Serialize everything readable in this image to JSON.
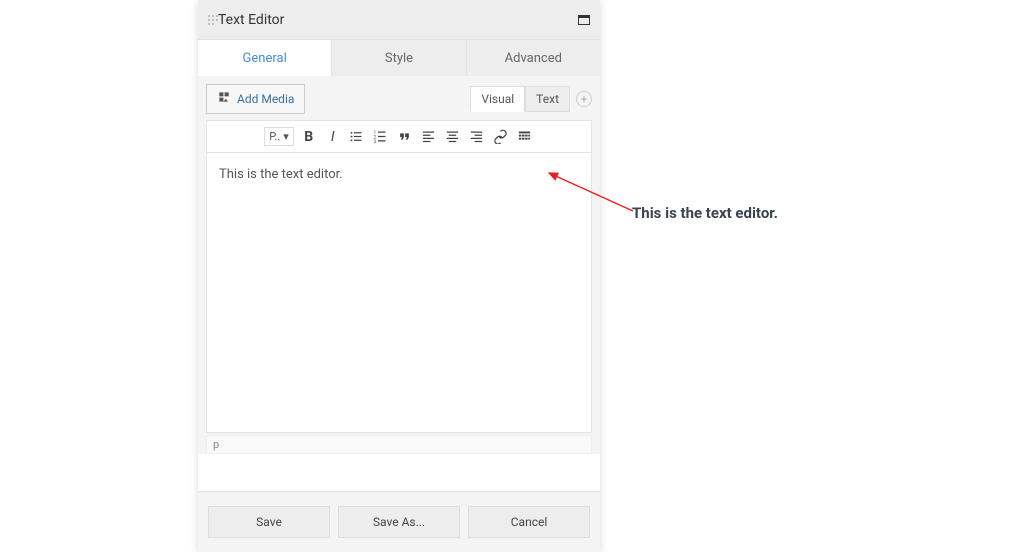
{
  "header": {
    "title": "Text Editor"
  },
  "tabs": {
    "general": "General",
    "style": "Style",
    "advanced": "Advanced"
  },
  "media": {
    "add_media_label": "Add Media"
  },
  "mode": {
    "visual": "Visual",
    "text": "Text"
  },
  "toolbar": {
    "format_label": "P.."
  },
  "content": {
    "text": "This is the text editor."
  },
  "status": {
    "element": "p"
  },
  "footer": {
    "save": "Save",
    "save_as": "Save As...",
    "cancel": "Cancel"
  },
  "annotation": {
    "label": "This is the text editor."
  }
}
